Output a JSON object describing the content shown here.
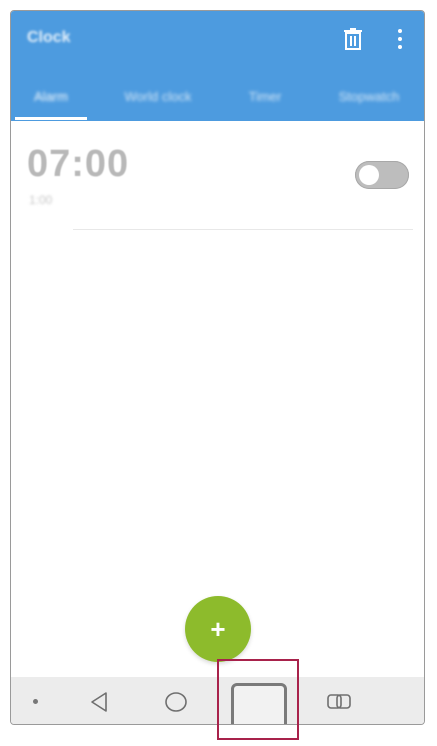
{
  "app": {
    "title": "Clock"
  },
  "toolbar": {
    "icons": [
      "trash-icon",
      "more-icon"
    ]
  },
  "tabs": [
    {
      "label": "Alarm",
      "active": true
    },
    {
      "label": "World clock",
      "active": false
    },
    {
      "label": "Timer",
      "active": false
    },
    {
      "label": "Stopwatch",
      "active": false
    }
  ],
  "alarm": {
    "time": "07:00",
    "subtitle": "1:00",
    "enabled": false
  },
  "fab": {
    "label": "+"
  },
  "navbar": {
    "icons": [
      "dot-icon",
      "back-icon",
      "home-icon",
      "recents-icon",
      "dual-window-icon"
    ],
    "highlighted": "recents-icon"
  },
  "colors": {
    "appbar": "#4d9bdf",
    "fab": "#8dbb2c",
    "highlight": "#a8224b",
    "navbar": "#ececec"
  }
}
